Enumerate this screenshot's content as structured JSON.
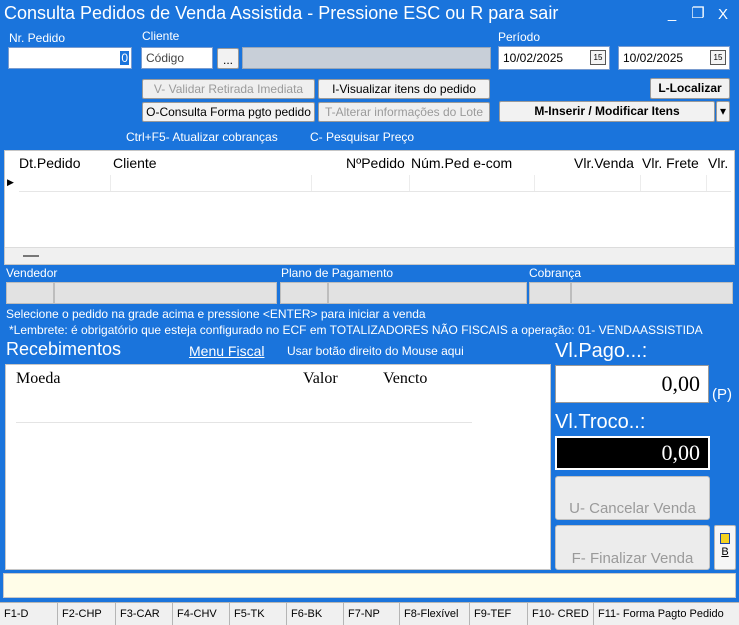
{
  "window": {
    "title": "Consulta Pedidos de Venda Assistida - Pressione ESC ou R para sair",
    "min_glyph": "_",
    "restore_glyph": "❐",
    "close_glyph": "X"
  },
  "header": {
    "nr_pedido_label": "Nr. Pedido",
    "nr_pedido_value": "0",
    "cliente_label": "Cliente",
    "cliente_codigo_placeholder": "Código",
    "cliente_browse_label": "...",
    "periodo_label": "Período",
    "periodo_inicio": "10/02/2025",
    "periodo_fim": "10/02/2025",
    "calendar_glyph": "15"
  },
  "actions": {
    "validar_retirada": "V- Validar Retirada Imediata",
    "visualizar_itens": "I-Visualizar itens do pedido",
    "localizar": "L-Localizar",
    "consulta_forma_pgto": "O-Consulta Forma pgto pedido",
    "alterar_lote": "T-Alterar informações do Lote",
    "inserir_modificar": "M-Inserir / Modificar Itens",
    "dropdown_glyph": "▾"
  },
  "shortcuts": {
    "atualizar_cobrancas": "Ctrl+F5- Atualizar cobranças",
    "pesquisar_preco": "C- Pesquisar Preço"
  },
  "orders_grid": {
    "columns": [
      "Dt.Pedido",
      "Cliente",
      "NºPedido",
      "Núm.Ped e-com",
      "Vlr.Venda",
      "Vlr. Frete",
      "Vlr."
    ],
    "row_indicator": "▶"
  },
  "details": {
    "vendedor_label": "Vendedor",
    "plano_label": "Plano de Pagamento",
    "cobranca_label": "Cobrança"
  },
  "messages": {
    "instrucao": "Selecione o pedido na grade acima e pressione <ENTER> para iniciar a venda",
    "lembrete": "*Lembrete: é obrigatório que esteja configurado  no ECF em TOTALIZADORES NÃO FISCAIS a operação: 01- VENDAASSISTIDA"
  },
  "recebimentos": {
    "title": "Recebimentos",
    "menu_fiscal": "Menu Fiscal",
    "mouse_hint": "Usar botão direito do Mouse aqui",
    "columns": [
      "Moeda",
      "Valor",
      "Vencto"
    ]
  },
  "totals": {
    "vl_pago_label": "Vl.Pago...:",
    "vl_pago_value": "0,00",
    "pago_suffix": "(P)",
    "vl_troco_label": "Vl.Troco..:",
    "vl_troco_value": "0,00"
  },
  "buttons": {
    "cancelar_venda": "U- Cancelar Venda",
    "finalizar_venda": "F- Finalizar Venda",
    "side_letter": "B"
  },
  "function_keys": [
    "F1-D",
    "F2-CHP",
    "F3-CAR",
    "F4-CHV",
    "F5-TK",
    "F6-BK",
    "F7-NP",
    "F8-Flexível",
    "F9-TEF",
    "F10- CRED",
    "F11- Forma Pagto Pedido"
  ],
  "colors": {
    "background": "#1a74dc",
    "status_bar": "#fffde8",
    "troco_box": "#000000"
  }
}
